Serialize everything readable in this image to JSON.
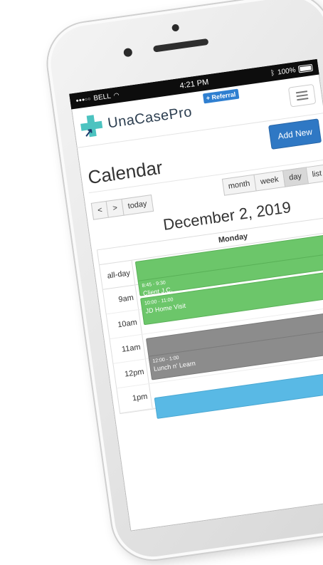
{
  "status_bar": {
    "carrier": "BELL",
    "time": "4:21 PM",
    "battery": "100%"
  },
  "navbar": {
    "brand": "UnaCasePro",
    "referral_badge": "+ Referral"
  },
  "page": {
    "title": "Calendar",
    "add_new_label": "Add New"
  },
  "toolbar": {
    "prev_label": "<",
    "next_label": ">",
    "today_label": "today",
    "views": [
      {
        "label": "month",
        "active": false
      },
      {
        "label": "week",
        "active": false
      },
      {
        "label": "day",
        "active": true
      },
      {
        "label": "list",
        "active": false
      }
    ]
  },
  "calendar": {
    "date_title": "December 2, 2019",
    "day_header": "Monday",
    "allday_label": "all-day",
    "time_labels": [
      "9am",
      "10am",
      "11am",
      "12pm",
      "1pm"
    ],
    "events": [
      {
        "time": "8:45 - 9:30",
        "title": "Client J.C.",
        "color": "#6cc66a"
      },
      {
        "time": "10:00 - 11:00",
        "title": "JD Home Visit",
        "color": "#6cc66a"
      },
      {
        "time": "12:00 - 1:00",
        "title": "Lunch n' Learn",
        "color": "#8c8c8c"
      }
    ]
  },
  "colors": {
    "primary_button": "#2f78c4",
    "logo_teal": "#4cc3c0",
    "event_green": "#6cc66a",
    "event_gray": "#8c8c8c",
    "event_blue": "#59b9e5"
  }
}
